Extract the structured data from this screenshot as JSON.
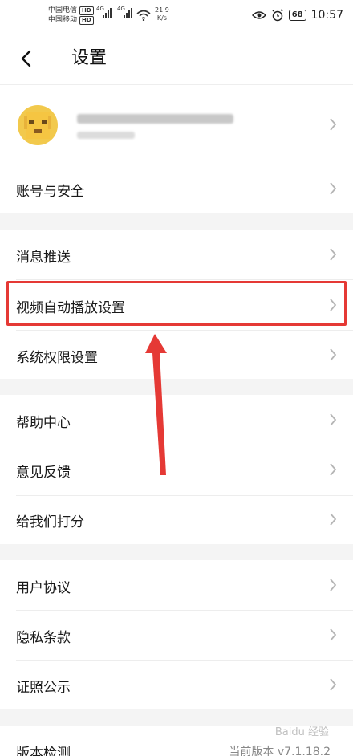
{
  "status_bar": {
    "carrier_1": "中国电信",
    "carrier_2": "中国移动",
    "hd_label": "HD",
    "network_label": "4G",
    "speed_value": "21.9",
    "speed_unit": "K/s",
    "battery": "68",
    "time": "10:57"
  },
  "header": {
    "title": "设置"
  },
  "settings": {
    "account_security": "账号与安全",
    "message_push": "消息推送",
    "video_autoplay": "视频自动播放设置",
    "system_permissions": "系统权限设置",
    "help_center": "帮助中心",
    "feedback": "意见反馈",
    "rate_us": "给我们打分",
    "user_agreement": "用户协议",
    "privacy_terms": "隐私条款",
    "license": "证照公示",
    "version_check": "版本检测",
    "version_value": "当前版本 v7.1.18.2"
  },
  "watermark": "Baidu 经验",
  "colors": {
    "highlight": "#e53935",
    "section_gap": "#f4f4f4",
    "chevron": "#b5b5b5"
  }
}
